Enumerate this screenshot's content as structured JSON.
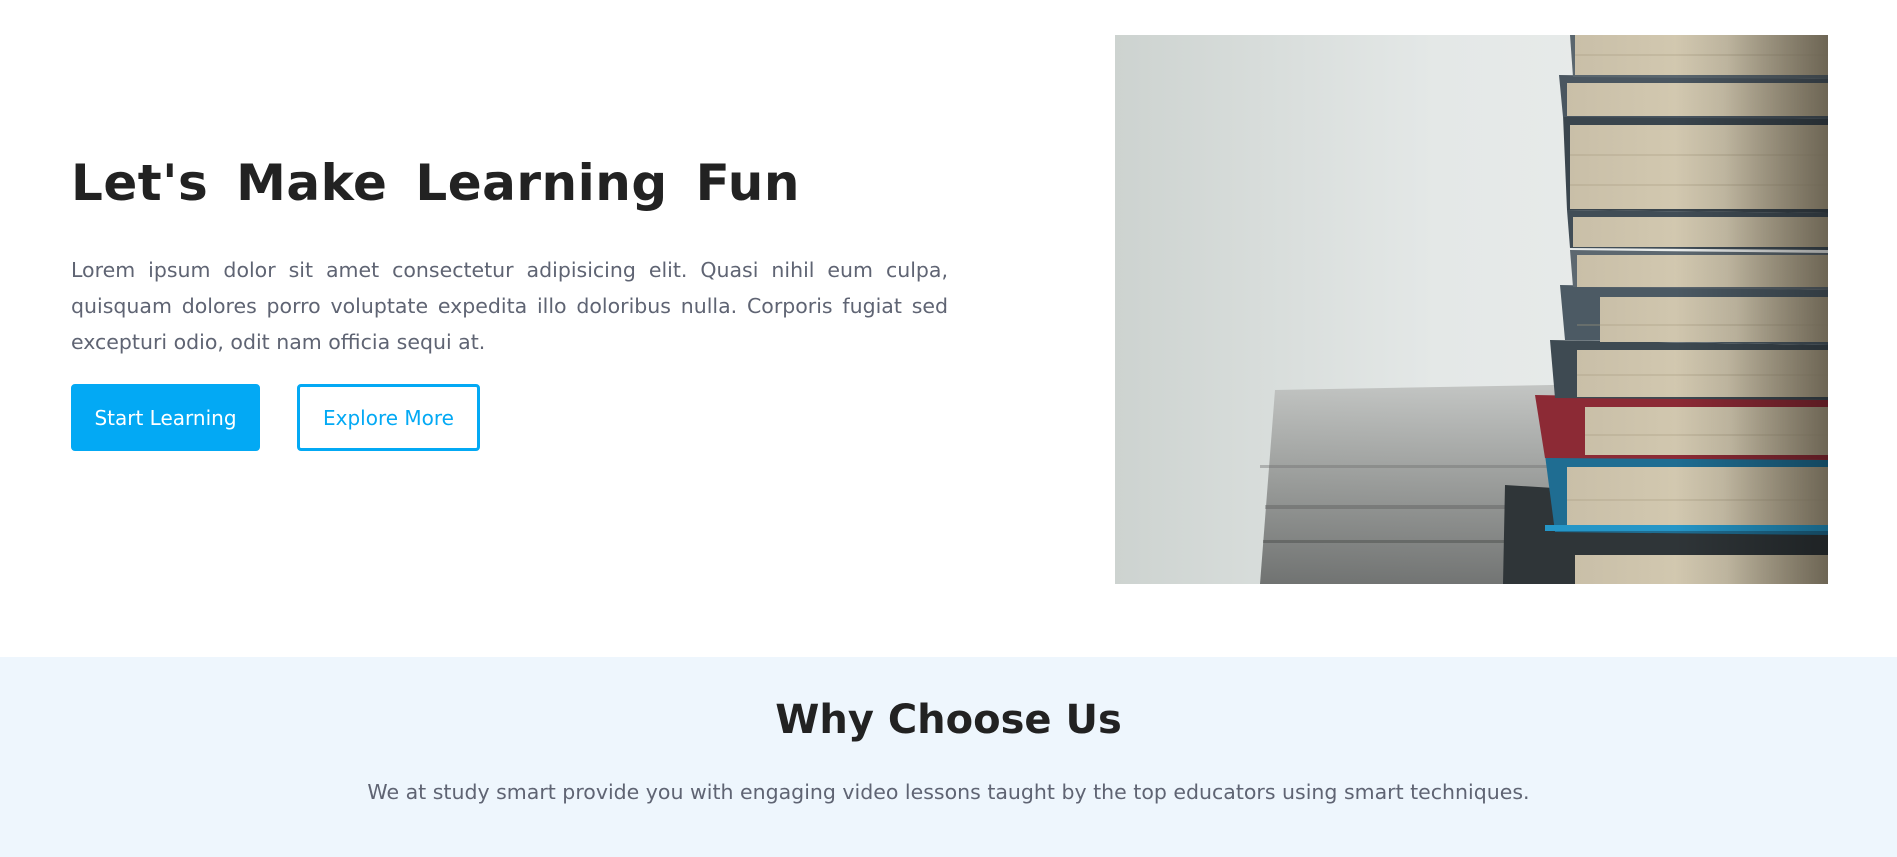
{
  "hero": {
    "title": "Let's Make Learning Fun",
    "description": "Lorem ipsum dolor sit amet consectetur adipisicing elit. Quasi nihil eum culpa, quisquam dolores porro voluptate expedita illo doloribus nulla. Corporis fugiat sed excepturi odio, odit nam officia sequi at.",
    "primary_button": "Start Learning",
    "secondary_button": "Explore More",
    "image_icon": "stack-of-books-photo"
  },
  "why_choose_us": {
    "title": "Why Choose Us",
    "subtitle": "We at study smart provide you with engaging video lessons taught by the top educators using smart techniques."
  },
  "colors": {
    "accent": "#03a9f4",
    "heading": "#222222",
    "body_text": "#5f6473",
    "section_background": "#eef6fd"
  }
}
